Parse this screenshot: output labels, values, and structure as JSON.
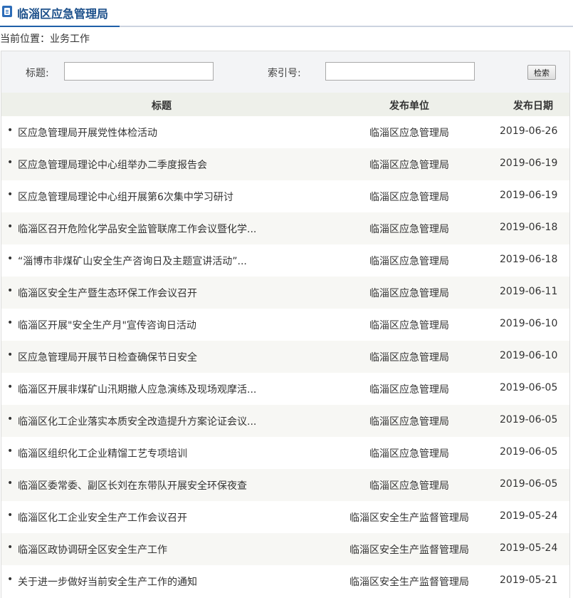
{
  "header": {
    "title": "临淄区应急管理局",
    "icon": "document-icon"
  },
  "breadcrumb": {
    "label": "当前位置：",
    "current": "业务工作"
  },
  "search": {
    "title_label": "标题:",
    "title_value": "",
    "index_label": "索引号:",
    "index_value": "",
    "button_label": "检索"
  },
  "table": {
    "headers": {
      "title": "标题",
      "unit": "发布单位",
      "date": "发布日期"
    },
    "rows": [
      {
        "title": "区应急管理局开展党性体检活动",
        "unit": "临淄区应急管理局",
        "date": "2019-06-26"
      },
      {
        "title": "区应急管理局理论中心组举办二季度报告会",
        "unit": "临淄区应急管理局",
        "date": "2019-06-19"
      },
      {
        "title": "区应急管理局理论中心组开展第6次集中学习研讨",
        "unit": "临淄区应急管理局",
        "date": "2019-06-19"
      },
      {
        "title": "临淄区召开危险化学品安全监管联席工作会议暨化学...",
        "unit": "临淄区应急管理局",
        "date": "2019-06-18"
      },
      {
        "title": "“淄博市非煤矿山安全生产咨询日及主题宣讲活动”...",
        "unit": "临淄区应急管理局",
        "date": "2019-06-18"
      },
      {
        "title": "临淄区安全生产暨生态环保工作会议召开",
        "unit": "临淄区应急管理局",
        "date": "2019-06-11"
      },
      {
        "title": "临淄区开展\"安全生产月\"宣传咨询日活动",
        "unit": "临淄区应急管理局",
        "date": "2019-06-10"
      },
      {
        "title": "区应急管理局开展节日检查确保节日安全",
        "unit": "临淄区应急管理局",
        "date": "2019-06-10"
      },
      {
        "title": "临淄区开展非煤矿山汛期撤人应急演练及现场观摩活...",
        "unit": "临淄区应急管理局",
        "date": "2019-06-05"
      },
      {
        "title": "临淄区化工企业落实本质安全改造提升方案论证会议...",
        "unit": "临淄区应急管理局",
        "date": "2019-06-05"
      },
      {
        "title": "临淄区组织化工企业精馏工艺专项培训",
        "unit": "临淄区应急管理局",
        "date": "2019-06-05"
      },
      {
        "title": "临淄区委常委、副区长刘在东带队开展安全环保夜查",
        "unit": "临淄区应急管理局",
        "date": "2019-06-05"
      },
      {
        "title": "临淄区化工企业安全生产工作会议召开",
        "unit": "临淄区安全生产监督管理局",
        "date": "2019-05-24"
      },
      {
        "title": "临淄区政协调研全区安全生产工作",
        "unit": "临淄区安全生产监督管理局",
        "date": "2019-05-24"
      },
      {
        "title": "关于进一步做好当前安全生产工作的通知",
        "unit": "临淄区安全生产监督管理局",
        "date": "2019-05-21"
      }
    ]
  }
}
